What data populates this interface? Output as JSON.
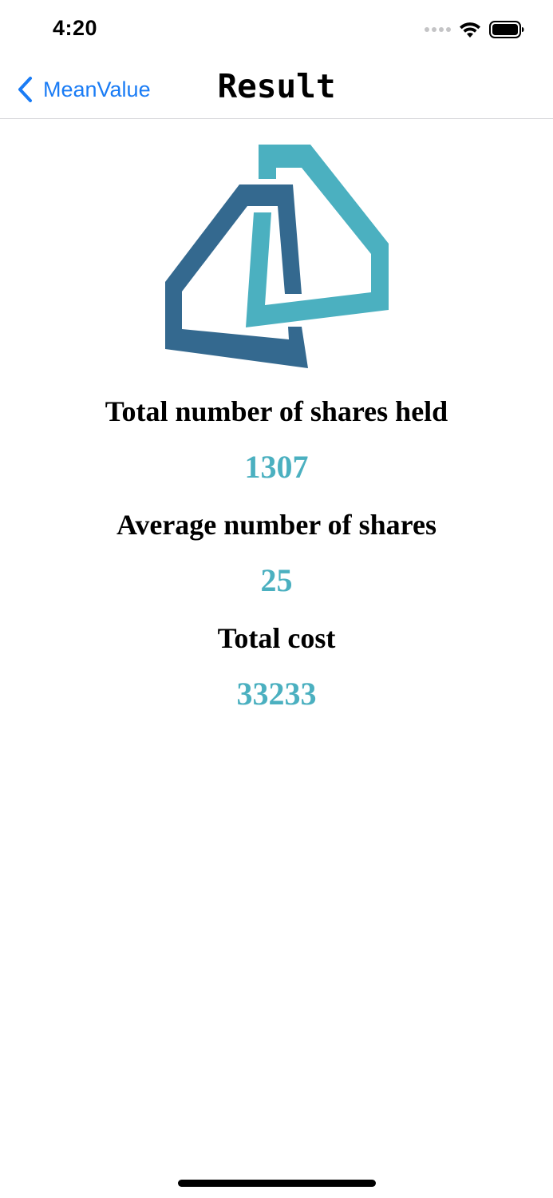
{
  "status_bar": {
    "time": "4:20"
  },
  "nav": {
    "back_label": "MeanValue",
    "title": "Result"
  },
  "stats": [
    {
      "label": "Total number of shares held",
      "value": "1307"
    },
    {
      "label": "Average number of shares",
      "value": "25"
    },
    {
      "label": "Total cost",
      "value": "33233"
    }
  ],
  "colors": {
    "accent": "#4bb0c0",
    "logo_dark": "#34698f",
    "logo_light": "#4bb0c0",
    "link": "#1a7cf5"
  },
  "icons": [
    "wifi-icon",
    "battery-icon",
    "cellular-signal-icon",
    "back-chevron-icon",
    "app-logo"
  ]
}
